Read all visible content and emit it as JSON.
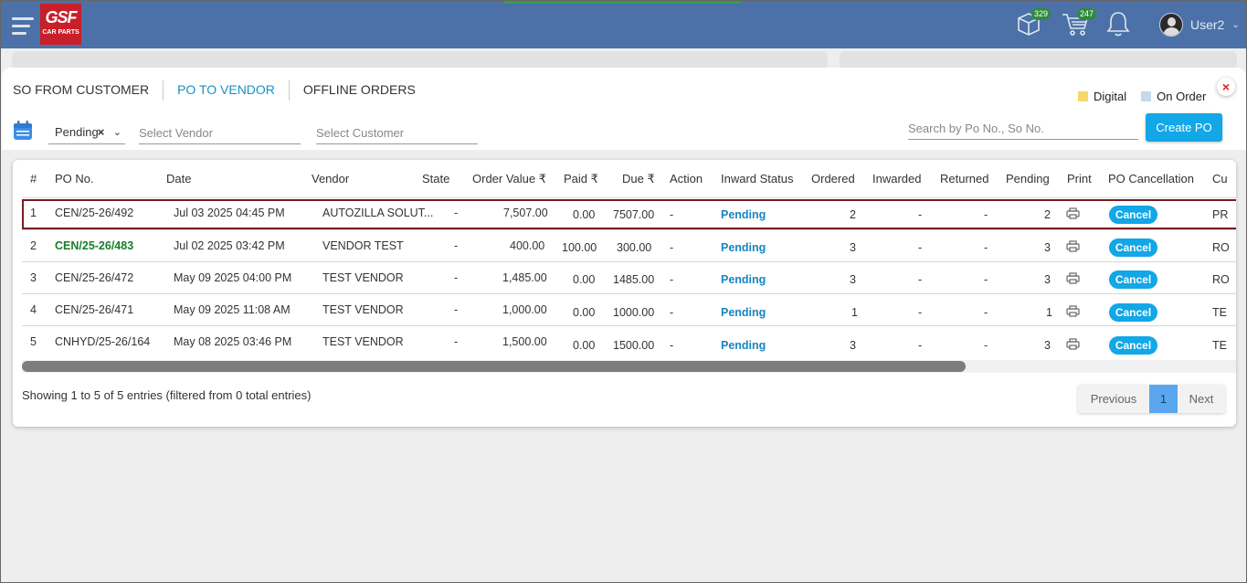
{
  "topbar": {
    "logo_text": "GSF",
    "logo_sub": "CAR PARTS",
    "box_badge": "329",
    "cart_badge": "247",
    "user_name": "User2"
  },
  "tabs": [
    {
      "label": "SO FROM CUSTOMER",
      "active": false
    },
    {
      "label": "PO TO VENDOR",
      "active": true
    },
    {
      "label": "OFFLINE ORDERS",
      "active": false
    }
  ],
  "close_label": "×",
  "legend": [
    {
      "label": "Digital",
      "color": "#f5d76a"
    },
    {
      "label": "On Order",
      "color": "#c6d8ea"
    }
  ],
  "filters": {
    "status_value": "Pending",
    "status_clear": "×",
    "vendor_placeholder": "Select Vendor",
    "customer_placeholder": "Select Customer",
    "search_placeholder": "Search by Po No., So No.",
    "create_label": "Create PO"
  },
  "table": {
    "headers": {
      "idx": "#",
      "po": "PO No.",
      "date": "Date",
      "vendor": "Vendor",
      "state": "State",
      "order_value": "Order Value ₹",
      "paid": "Paid ₹",
      "due": "Due ₹",
      "action": "Action",
      "inward_status": "Inward Status",
      "ordered": "Ordered",
      "inwarded": "Inwarded",
      "returned": "Returned",
      "pending": "Pending",
      "print": "Print",
      "cancellation": "PO Cancellation",
      "cu": "Cu"
    },
    "rows": [
      {
        "idx": "1",
        "po": "CEN/25-26/492",
        "date": "Jul 03 2025 04:45 PM",
        "vendor": "AUTOZILLA SOLUT...",
        "state": "-",
        "order_value": "7,507.00",
        "paid": "0.00",
        "due": "7507.00",
        "action": "-",
        "inward_status": "Pending",
        "ordered": "2",
        "inwarded": "-",
        "returned": "-",
        "pending": "2",
        "cancel": "Cancel",
        "cu": "PR",
        "po_green": false
      },
      {
        "idx": "2",
        "po": "CEN/25-26/483",
        "date": "Jul 02 2025 03:42 PM",
        "vendor": "VENDOR TEST",
        "state": "-",
        "order_value": "400.00",
        "paid": "100.00",
        "due": "300.00",
        "action": "-",
        "inward_status": "Pending",
        "ordered": "3",
        "inwarded": "-",
        "returned": "-",
        "pending": "3",
        "cancel": "Cancel",
        "cu": "RO",
        "po_green": true
      },
      {
        "idx": "3",
        "po": "CEN/25-26/472",
        "date": "May 09 2025 04:00 PM",
        "vendor": "TEST VENDOR",
        "state": "-",
        "order_value": "1,485.00",
        "paid": "0.00",
        "due": "1485.00",
        "action": "-",
        "inward_status": "Pending",
        "ordered": "3",
        "inwarded": "-",
        "returned": "-",
        "pending": "3",
        "cancel": "Cancel",
        "cu": "RO",
        "po_green": false
      },
      {
        "idx": "4",
        "po": "CEN/25-26/471",
        "date": "May 09 2025 11:08 AM",
        "vendor": "TEST VENDOR",
        "state": "-",
        "order_value": "1,000.00",
        "paid": "0.00",
        "due": "1000.00",
        "action": "-",
        "inward_status": "Pending",
        "ordered": "1",
        "inwarded": "-",
        "returned": "-",
        "pending": "1",
        "cancel": "Cancel",
        "cu": "TE",
        "po_green": false
      },
      {
        "idx": "5",
        "po": "CNHYD/25-26/164",
        "date": "May 08 2025 03:46 PM",
        "vendor": "TEST VENDOR",
        "state": "-",
        "order_value": "1,500.00",
        "paid": "0.00",
        "due": "1500.00",
        "action": "-",
        "inward_status": "Pending",
        "ordered": "3",
        "inwarded": "-",
        "returned": "-",
        "pending": "3",
        "cancel": "Cancel",
        "cu": "TE",
        "po_green": false
      }
    ]
  },
  "footer": {
    "showing": "Showing 1 to 5 of 5 entries (filtered from 0 total entries)",
    "prev": "Previous",
    "page": "1",
    "next": "Next"
  },
  "colors": {
    "topbar": "#4b71a8",
    "accent": "#12a7e6",
    "highlight_border": "#7a1a1f",
    "pending_text": "#1884c0",
    "green_po": "#1a7d2d"
  }
}
